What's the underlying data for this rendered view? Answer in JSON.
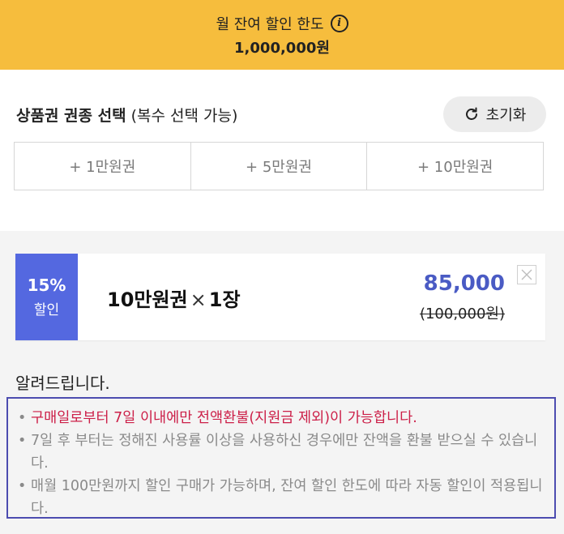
{
  "limit": {
    "label": "월 잔여 할인 한도",
    "info_icon": "info-icon",
    "amount": "1,000,000원"
  },
  "selection": {
    "title_bold": "상품권 권종 선택",
    "title_note": "(복수 선택 가능)",
    "reset_label": "초기화",
    "reset_icon": "refresh-icon",
    "amounts": [
      "+ 1만원권",
      "+ 5만원권",
      "+ 10만원권"
    ]
  },
  "ticket": {
    "discount_rate": "15%",
    "discount_label": "할인",
    "name": "10만원권",
    "times": "×",
    "quantity": "1장",
    "price": "85,000",
    "original_price": "(100,000원)",
    "remove_icon": "close-icon",
    "badge_color": "#5468e0",
    "price_color": "#4a5bc4"
  },
  "notice": {
    "title": "알려드립니다.",
    "items": [
      "구매일로부터 7일 이내에만 전액환불(지원금 제외)이 가능합니다.",
      "7일 후 부터는 정해진 사용률 이상을 사용하신 경우에만 잔액을 환불 받으실 수 있습니다.",
      "매월 100만원까지 할인 구매가 가능하며, 잔여 할인 한도에 따라 자동 할인이 적용됩니다."
    ],
    "alert_color": "#cc1f48"
  },
  "colors": {
    "banner": "#f6bd3d",
    "accent": "#5468e0"
  }
}
